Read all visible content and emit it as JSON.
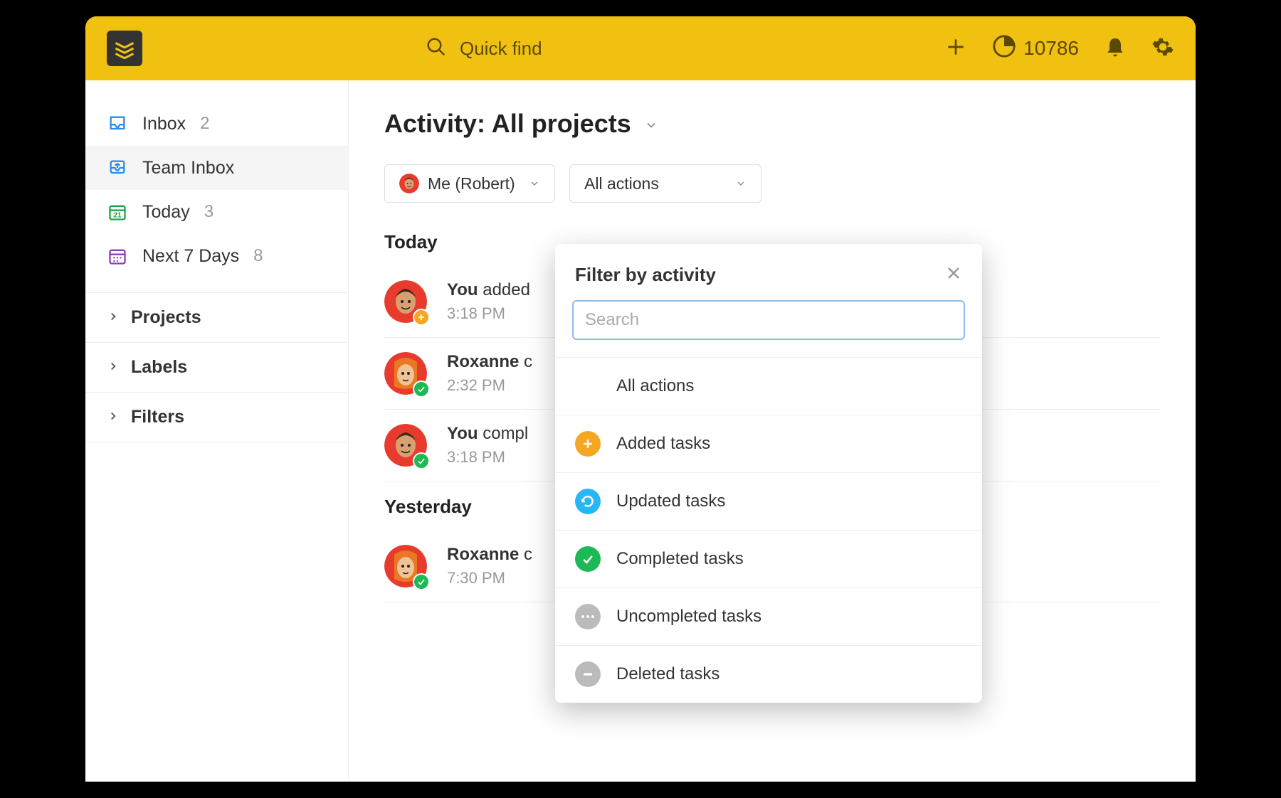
{
  "header": {
    "search_label": "Quick find",
    "points": "10786"
  },
  "sidebar": {
    "items": [
      {
        "label": "Inbox",
        "count": "2",
        "icon": "inbox",
        "color": "#2a8cf0"
      },
      {
        "label": "Team Inbox",
        "count": "",
        "icon": "team-inbox",
        "color": "#2a8cf0"
      },
      {
        "label": "Today",
        "count": "3",
        "icon": "today",
        "color": "#1ba548"
      },
      {
        "label": "Next 7 Days",
        "count": "8",
        "icon": "calendar",
        "color": "#8b3fbf"
      }
    ],
    "sections": [
      {
        "label": "Projects"
      },
      {
        "label": "Labels"
      },
      {
        "label": "Filters"
      }
    ]
  },
  "page": {
    "title": "Activity: All projects"
  },
  "filters": {
    "user": "Me (Robert)",
    "actions": "All actions"
  },
  "activity": {
    "groups": [
      {
        "label": "Today",
        "items": [
          {
            "actor": "You",
            "verb": "added",
            "time": "3:18 PM",
            "avatar": "robert",
            "badge": "plus"
          },
          {
            "actor": "Roxanne",
            "verb": "c",
            "time": "2:32 PM",
            "avatar": "roxanne",
            "badge": "check"
          },
          {
            "actor": "You",
            "verb": "compl",
            "time": "3:18 PM",
            "avatar": "robert",
            "badge": "check"
          }
        ]
      },
      {
        "label": "Yesterday",
        "items": [
          {
            "actor": "Roxanne",
            "verb": "c",
            "time": "7:30 PM",
            "avatar": "roxanne",
            "badge": "check"
          }
        ]
      }
    ]
  },
  "popover": {
    "title": "Filter by activity",
    "search_placeholder": "Search",
    "items": [
      {
        "label": "All actions",
        "icon": "none"
      },
      {
        "label": "Added tasks",
        "icon": "added"
      },
      {
        "label": "Updated tasks",
        "icon": "updated"
      },
      {
        "label": "Completed tasks",
        "icon": "completed"
      },
      {
        "label": "Uncompleted tasks",
        "icon": "uncompleted"
      },
      {
        "label": "Deleted tasks",
        "icon": "deleted"
      }
    ]
  }
}
